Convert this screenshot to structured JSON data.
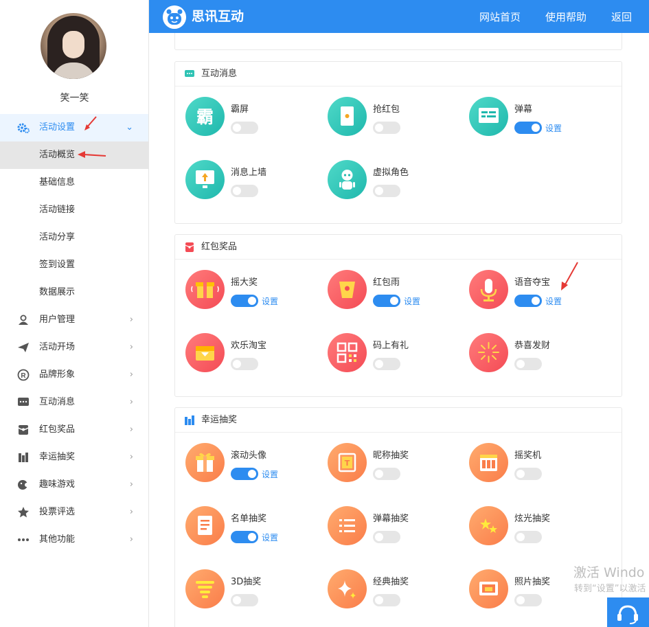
{
  "user": {
    "name": "笑一笑"
  },
  "header": {
    "logo_text": "思讯互动",
    "nav": [
      "网站首页",
      "使用帮助",
      "返回"
    ]
  },
  "sidebar": {
    "items": [
      {
        "label": "活动设置",
        "icon": "gear-icon",
        "state": "expanded"
      },
      {
        "label": "活动概览",
        "sub": true,
        "active": true
      },
      {
        "label": "基础信息",
        "sub": true
      },
      {
        "label": "活动链接",
        "sub": true
      },
      {
        "label": "活动分享",
        "sub": true
      },
      {
        "label": "签到设置",
        "sub": true
      },
      {
        "label": "数据展示",
        "sub": true
      },
      {
        "label": "用户管理",
        "icon": "user-manage-icon"
      },
      {
        "label": "活动开场",
        "icon": "paper-plane-icon"
      },
      {
        "label": "品牌形象",
        "icon": "registered-icon"
      },
      {
        "label": "互动消息",
        "icon": "chat-icon"
      },
      {
        "label": "红包奖品",
        "icon": "red-packet-icon"
      },
      {
        "label": "幸运抽奖",
        "icon": "lottery-icon"
      },
      {
        "label": "趣味游戏",
        "icon": "game-icon"
      },
      {
        "label": "投票评选",
        "icon": "star-icon"
      },
      {
        "label": "其他功能",
        "icon": "more-icon"
      }
    ]
  },
  "settings_label": "设置",
  "sections": [
    {
      "title": "互动消息",
      "features": [
        {
          "name": "霸屏",
          "icon": "ba-screen-icon",
          "enabled": false
        },
        {
          "name": "抢红包",
          "icon": "red-envelope-icon",
          "enabled": false
        },
        {
          "name": "弹幕",
          "icon": "danmaku-icon",
          "enabled": true
        },
        {
          "name": "消息上墙",
          "icon": "message-wall-icon",
          "enabled": false
        },
        {
          "name": "虚拟角色",
          "icon": "robot-icon",
          "enabled": false
        }
      ]
    },
    {
      "title": "红包奖品",
      "features": [
        {
          "name": "摇大奖",
          "icon": "gift-shake-icon",
          "enabled": true
        },
        {
          "name": "红包雨",
          "icon": "red-packet-rain-icon",
          "enabled": true
        },
        {
          "name": "语音夺宝",
          "icon": "microphone-icon",
          "enabled": true
        },
        {
          "name": "欢乐淘宝",
          "icon": "treasure-chest-icon",
          "enabled": false
        },
        {
          "name": "码上有礼",
          "icon": "qr-code-icon",
          "enabled": false
        },
        {
          "name": "恭喜发财",
          "icon": "firework-icon",
          "enabled": false
        }
      ]
    },
    {
      "title": "幸运抽奖",
      "features": [
        {
          "name": "滚动头像",
          "icon": "gift-box-icon",
          "enabled": true
        },
        {
          "name": "昵称抽奖",
          "icon": "nickname-card-icon",
          "enabled": false
        },
        {
          "name": "摇奖机",
          "icon": "slot-machine-icon",
          "enabled": false
        },
        {
          "name": "名单抽奖",
          "icon": "list-sheet-icon",
          "enabled": true
        },
        {
          "name": "弹幕抽奖",
          "icon": "danmaku-list-icon",
          "enabled": false
        },
        {
          "name": "炫光抽奖",
          "icon": "sparkle-stars-icon",
          "enabled": false
        },
        {
          "name": "3D抽奖",
          "icon": "tornado-icon",
          "enabled": false
        },
        {
          "name": "经典抽奖",
          "icon": "twinkle-icon",
          "enabled": false
        },
        {
          "name": "照片抽奖",
          "icon": "photo-icon",
          "enabled": false
        }
      ]
    }
  ],
  "watermark": {
    "line1": "激活 Windo",
    "line2": "转到“设置”以激活"
  },
  "colors": {
    "primary": "#2d8cf0",
    "teal": "#1fb8ad",
    "red": "#f44b55",
    "orange": "#fa7d4a"
  }
}
